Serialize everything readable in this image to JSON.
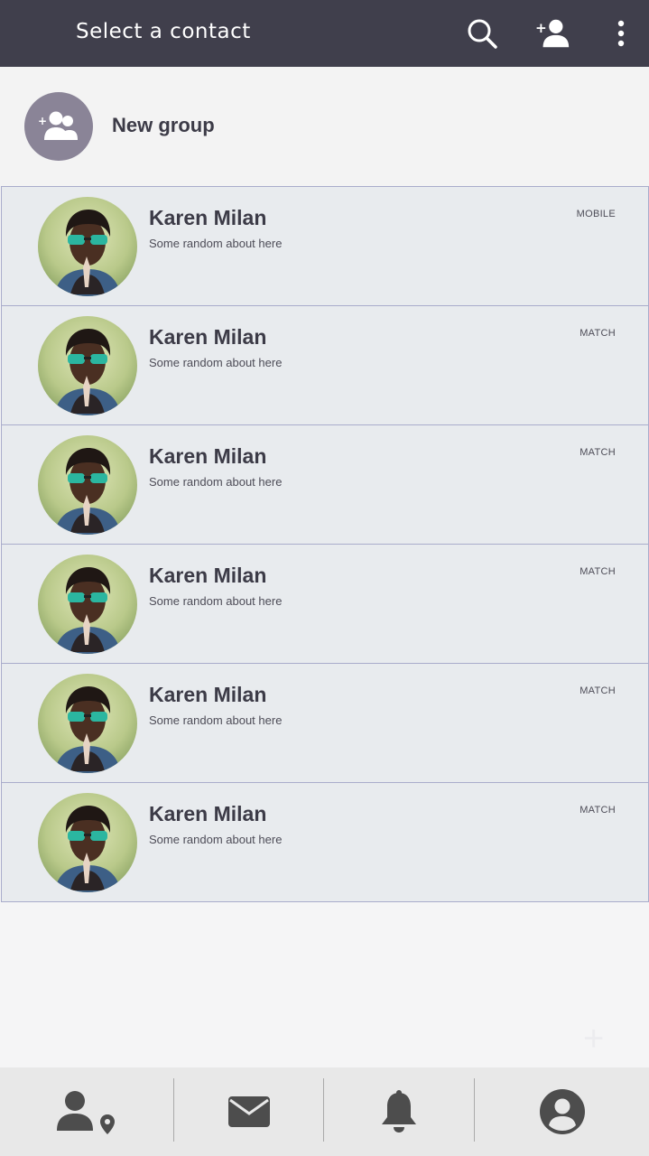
{
  "appbar": {
    "title": "Select a contact",
    "icons": [
      "search-icon",
      "add-contact-icon",
      "more-vert-icon"
    ]
  },
  "new_group": {
    "label": "New group",
    "icon": "add-group-icon"
  },
  "contacts": [
    {
      "name": "Karen Milan",
      "about": "Some random about here",
      "type": "MOBILE"
    },
    {
      "name": "Karen Milan",
      "about": "Some random about here",
      "type": "MATCH"
    },
    {
      "name": "Karen Milan",
      "about": "Some random about here",
      "type": "MATCH"
    },
    {
      "name": "Karen Milan",
      "about": "Some random about here",
      "type": "MATCH"
    },
    {
      "name": "Karen Milan",
      "about": "Some random about here",
      "type": "MATCH"
    },
    {
      "name": "Karen Milan",
      "about": "Some random about here",
      "type": "MATCH"
    }
  ],
  "bottom_nav": {
    "items": [
      "nearby-people-icon",
      "messages-icon",
      "notifications-icon",
      "profile-icon"
    ]
  },
  "colors": {
    "appbar": "#403f4c",
    "accent": "#8a8497",
    "row_bg": "#e8ebee",
    "row_border": "#a9accb",
    "nav_icon": "#4d4d4d"
  }
}
